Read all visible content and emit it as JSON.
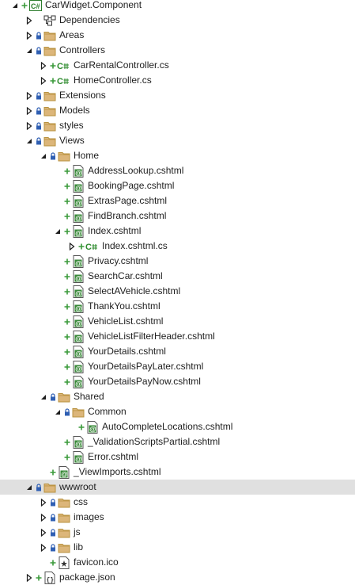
{
  "colors": {
    "add": "#3a9a3a",
    "lock": "#2f5fb3",
    "folder_fill": "#dcb67a",
    "folder_stroke": "#b8923f",
    "csharp": "#2d8b2d",
    "razor_green": "#3a8a3a",
    "selection": "#e0e0e0",
    "chevron": "#1e1e1e"
  },
  "tree": [
    {
      "label": "CarWidget.Component",
      "depth": 0,
      "expander": "expanded",
      "badge": "add",
      "icon": "csproj-icon"
    },
    {
      "label": "Dependencies",
      "depth": 1,
      "expander": "collapsed",
      "badge": "",
      "icon": "dependencies-icon"
    },
    {
      "label": "Areas",
      "depth": 1,
      "expander": "collapsed",
      "badge": "lock",
      "icon": "folder-icon"
    },
    {
      "label": "Controllers",
      "depth": 1,
      "expander": "expanded",
      "badge": "lock",
      "icon": "folder-icon"
    },
    {
      "label": "CarRentalController.cs",
      "depth": 2,
      "expander": "collapsed",
      "badge": "add",
      "icon": "csharp-file-icon"
    },
    {
      "label": "HomeController.cs",
      "depth": 2,
      "expander": "collapsed",
      "badge": "add",
      "icon": "csharp-file-icon"
    },
    {
      "label": "Extensions",
      "depth": 1,
      "expander": "collapsed",
      "badge": "lock",
      "icon": "folder-icon"
    },
    {
      "label": "Models",
      "depth": 1,
      "expander": "collapsed",
      "badge": "lock",
      "icon": "folder-icon"
    },
    {
      "label": "styles",
      "depth": 1,
      "expander": "collapsed",
      "badge": "lock",
      "icon": "folder-icon"
    },
    {
      "label": "Views",
      "depth": 1,
      "expander": "expanded",
      "badge": "lock",
      "icon": "folder-icon"
    },
    {
      "label": "Home",
      "depth": 2,
      "expander": "expanded",
      "badge": "lock",
      "icon": "folder-icon"
    },
    {
      "label": "AddressLookup.cshtml",
      "depth": 3,
      "expander": "none",
      "badge": "add",
      "icon": "razor-file-icon"
    },
    {
      "label": "BookingPage.cshtml",
      "depth": 3,
      "expander": "none",
      "badge": "add",
      "icon": "razor-file-icon"
    },
    {
      "label": "ExtrasPage.cshtml",
      "depth": 3,
      "expander": "none",
      "badge": "add",
      "icon": "razor-file-icon"
    },
    {
      "label": "FindBranch.cshtml",
      "depth": 3,
      "expander": "none",
      "badge": "add",
      "icon": "razor-file-icon"
    },
    {
      "label": "Index.cshtml",
      "depth": 3,
      "expander": "expanded",
      "badge": "add",
      "icon": "razor-file-icon"
    },
    {
      "label": "Index.cshtml.cs",
      "depth": 4,
      "expander": "collapsed",
      "badge": "add",
      "icon": "csharp-file-icon"
    },
    {
      "label": "Privacy.cshtml",
      "depth": 3,
      "expander": "none",
      "badge": "add",
      "icon": "razor-file-icon"
    },
    {
      "label": "SearchCar.cshtml",
      "depth": 3,
      "expander": "none",
      "badge": "add",
      "icon": "razor-file-icon"
    },
    {
      "label": "SelectAVehicle.cshtml",
      "depth": 3,
      "expander": "none",
      "badge": "add",
      "icon": "razor-file-icon"
    },
    {
      "label": "ThankYou.cshtml",
      "depth": 3,
      "expander": "none",
      "badge": "add",
      "icon": "razor-file-icon"
    },
    {
      "label": "VehicleList.cshtml",
      "depth": 3,
      "expander": "none",
      "badge": "add",
      "icon": "razor-file-icon"
    },
    {
      "label": "VehicleListFilterHeader.cshtml",
      "depth": 3,
      "expander": "none",
      "badge": "add",
      "icon": "razor-file-icon"
    },
    {
      "label": "YourDetails.cshtml",
      "depth": 3,
      "expander": "none",
      "badge": "add",
      "icon": "razor-file-icon"
    },
    {
      "label": "YourDetailsPayLater.cshtml",
      "depth": 3,
      "expander": "none",
      "badge": "add",
      "icon": "razor-file-icon"
    },
    {
      "label": "YourDetailsPayNow.cshtml",
      "depth": 3,
      "expander": "none",
      "badge": "add",
      "icon": "razor-file-icon"
    },
    {
      "label": "Shared",
      "depth": 2,
      "expander": "expanded",
      "badge": "lock",
      "icon": "folder-icon"
    },
    {
      "label": "Common",
      "depth": 3,
      "expander": "expanded",
      "badge": "lock",
      "icon": "folder-icon"
    },
    {
      "label": "AutoCompleteLocations.cshtml",
      "depth": 4,
      "expander": "none",
      "badge": "add",
      "icon": "razor-file-icon"
    },
    {
      "label": "_ValidationScriptsPartial.cshtml",
      "depth": 3,
      "expander": "none",
      "badge": "add",
      "icon": "razor-file-icon"
    },
    {
      "label": "Error.cshtml",
      "depth": 3,
      "expander": "none",
      "badge": "add",
      "icon": "razor-file-icon"
    },
    {
      "label": "_ViewImports.cshtml",
      "depth": 2,
      "expander": "none",
      "badge": "add",
      "icon": "razor-file-icon"
    },
    {
      "label": "wwwroot",
      "depth": 1,
      "expander": "expanded",
      "badge": "lock",
      "icon": "folder-icon",
      "selected": true
    },
    {
      "label": "css",
      "depth": 2,
      "expander": "collapsed",
      "badge": "lock",
      "icon": "folder-icon"
    },
    {
      "label": "images",
      "depth": 2,
      "expander": "collapsed",
      "badge": "lock",
      "icon": "folder-icon"
    },
    {
      "label": "js",
      "depth": 2,
      "expander": "collapsed",
      "badge": "lock",
      "icon": "folder-icon"
    },
    {
      "label": "lib",
      "depth": 2,
      "expander": "collapsed",
      "badge": "lock",
      "icon": "folder-icon"
    },
    {
      "label": "favicon.ico",
      "depth": 2,
      "expander": "none",
      "badge": "add",
      "icon": "ico-file-icon"
    },
    {
      "label": "package.json",
      "depth": 1,
      "expander": "collapsed",
      "badge": "add",
      "icon": "json-file-icon"
    }
  ]
}
